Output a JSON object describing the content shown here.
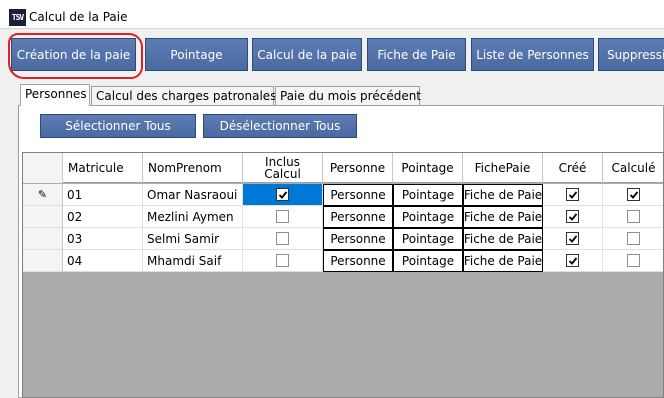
{
  "window": {
    "title": "Calcul de la Paie",
    "logo_text": "TSV"
  },
  "toolbar": {
    "buttons": [
      {
        "label": "Création de la paie"
      },
      {
        "label": "Pointage"
      },
      {
        "label": "Calcul de la paie"
      },
      {
        "label": "Fiche de Paie"
      },
      {
        "label": "Liste de Personnes"
      },
      {
        "label": "Suppressi"
      }
    ]
  },
  "tabs": [
    {
      "label": "Personnes",
      "active": true
    },
    {
      "label": "Calcul des charges patronales",
      "active": false
    },
    {
      "label": "Paie du mois précédent",
      "active": false
    }
  ],
  "actions": {
    "select_all": "Sélectionner Tous",
    "deselect_all": "Désélectionner Tous"
  },
  "grid": {
    "columns": [
      "Matricule",
      "NomPrenom",
      "Inclus Calcul",
      "Personne",
      "Pointage",
      "FichePaie",
      "Créé",
      "Calculé"
    ],
    "rows": [
      {
        "matricule": "01",
        "nom": "Omar  Nasraoui",
        "inclus": true,
        "personne": "Personne",
        "pointage": "Pointage",
        "fiche": "Fiche de Paie",
        "cree": true,
        "calcule": true,
        "editing": true
      },
      {
        "matricule": "02",
        "nom": "Mezlini  Aymen",
        "inclus": false,
        "personne": "Personne",
        "pointage": "Pointage",
        "fiche": "Fiche de Paie",
        "cree": true,
        "calcule": false,
        "editing": false
      },
      {
        "matricule": "03",
        "nom": "Selmi  Samir",
        "inclus": false,
        "personne": "Personne",
        "pointage": "Pointage",
        "fiche": "Fiche de Paie",
        "cree": true,
        "calcule": false,
        "editing": false
      },
      {
        "matricule": "04",
        "nom": "Mhamdi  Saif",
        "inclus": false,
        "personne": "Personne",
        "pointage": "Pointage",
        "fiche": "Fiche de Paie",
        "cree": true,
        "calcule": false,
        "editing": false
      }
    ]
  },
  "colors": {
    "button": "#4f6fa6",
    "selection": "#0078d7",
    "grid_empty": "#ababab",
    "annotation": "#e02020"
  }
}
